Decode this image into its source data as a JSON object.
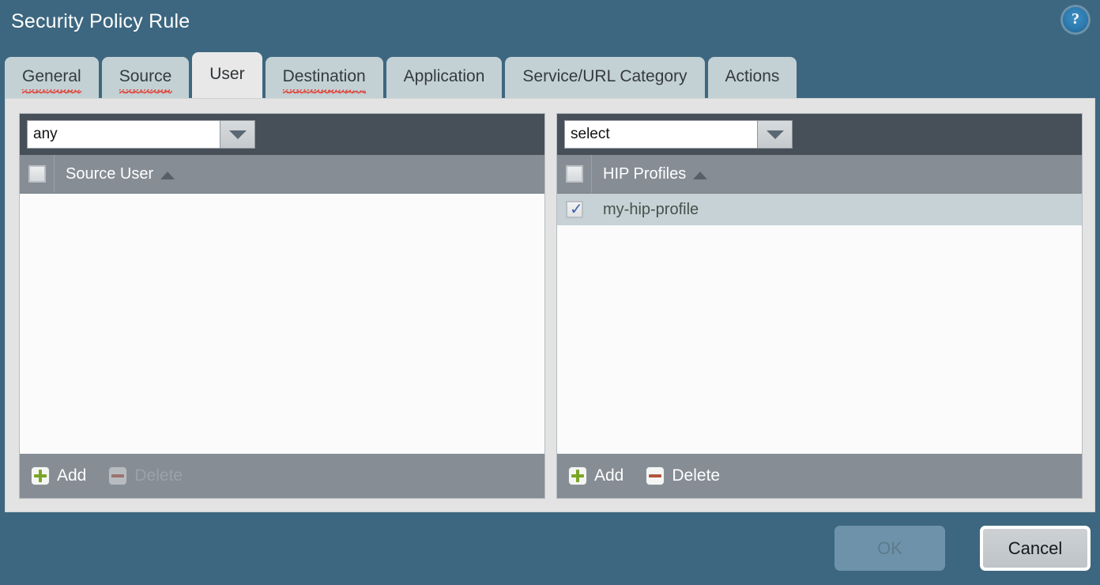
{
  "dialog": {
    "title": "Security Policy Rule",
    "help_icon": "help-question-icon",
    "help_glyph": "?"
  },
  "tabs": [
    {
      "label": "General",
      "active": false,
      "misspelled": true
    },
    {
      "label": "Source",
      "active": false,
      "misspelled": true
    },
    {
      "label": "User",
      "active": true,
      "misspelled": false
    },
    {
      "label": "Destination",
      "active": false,
      "misspelled": true
    },
    {
      "label": "Application",
      "active": false,
      "misspelled": false
    },
    {
      "label": "Service/URL Category",
      "active": false,
      "misspelled": false
    },
    {
      "label": "Actions",
      "active": false,
      "misspelled": false
    }
  ],
  "panels": {
    "source_user": {
      "filter_value": "any",
      "filter_placeholder": "any",
      "column_header": "Source User",
      "sort_direction": "ascending",
      "rows": [],
      "add_label": "Add",
      "delete_label": "Delete",
      "delete_enabled": false
    },
    "hip_profiles": {
      "filter_value": "select",
      "filter_placeholder": "select",
      "column_header": "HIP Profiles",
      "sort_direction": "ascending",
      "rows": [
        {
          "label": "my-hip-profile",
          "checked": true,
          "selected": true
        }
      ],
      "add_label": "Add",
      "delete_label": "Delete",
      "delete_enabled": true
    }
  },
  "footer": {
    "ok_label": "OK",
    "ok_enabled": false,
    "cancel_label": "Cancel",
    "cancel_enabled": true
  },
  "colors": {
    "window_blue": "#3d6780",
    "tab_inactive": "#c3d0d4",
    "tab_active": "#e8e8e8",
    "content_bg": "#e3e3e3",
    "toolbar_dark": "#474f59",
    "header_gray": "#868d95",
    "list_bg": "#fafbfa",
    "row_selected": "#c6d2d6",
    "check_blue": "#3f62a8",
    "add_green": "#7ba527",
    "delete_red": "#b3543f",
    "spellcheck_red": "#e04a3f"
  }
}
